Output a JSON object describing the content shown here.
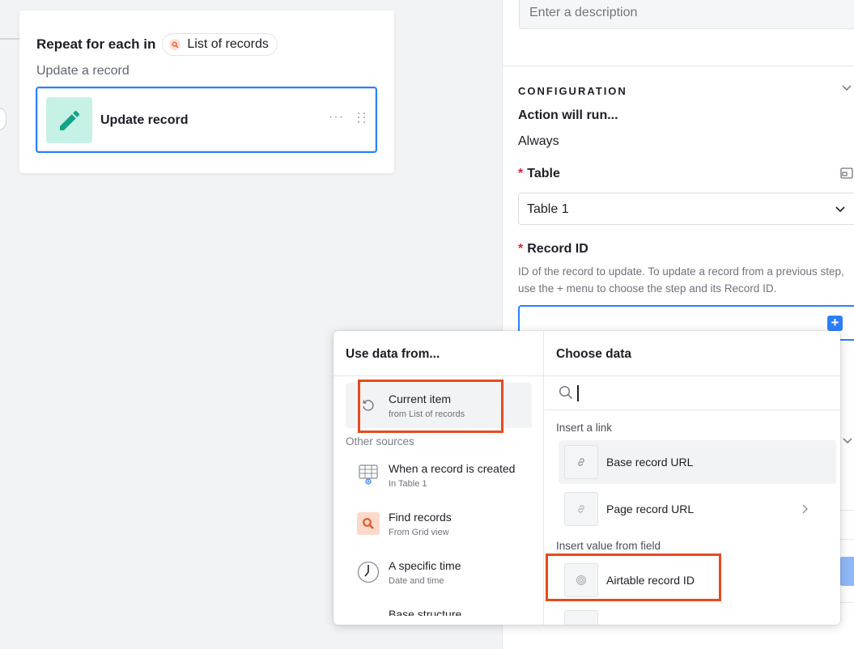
{
  "canvas": {
    "repeat_title": "Repeat for each in",
    "list_pill_label": "List of records",
    "update_label": "Update a record",
    "action_card_name": "Update record",
    "more_glyph": "···"
  },
  "panel": {
    "description_placeholder": "Enter a description",
    "config_title": "CONFIGURATION",
    "action_runs_label": "Action will run...",
    "action_runs_value": "Always",
    "required_mark": "*",
    "table_label": "Table",
    "table_value": "Table 1",
    "record_id_label": "Record ID",
    "record_id_help": "ID of the record to update. To update a record from a previous step, use the + menu to choose the step and its Record ID.",
    "plus_glyph": "+"
  },
  "popover": {
    "left_header": "Use data from...",
    "right_header": "Choose data",
    "current_item": {
      "title": "Current item",
      "sub": "from List of records"
    },
    "other_sources_label": "Other sources",
    "sources": [
      {
        "title": "When a record is created",
        "sub": "In Table 1",
        "icon": "table-created-icon"
      },
      {
        "title": "Find records",
        "sub": "From Grid view",
        "icon": "find-records-icon"
      },
      {
        "title": "A specific time",
        "sub": "Date and time",
        "icon": "clock-icon"
      },
      {
        "title": "Base structure",
        "sub": "",
        "icon": "base-structure-icon"
      }
    ],
    "search_placeholder": "",
    "insert_link_label": "Insert a link",
    "links": [
      {
        "label": "Base record URL",
        "icon": "link-icon"
      },
      {
        "label": "Page record URL",
        "icon": "link-icon"
      }
    ],
    "insert_field_label": "Insert value from field",
    "fields": [
      {
        "label": "Airtable record ID",
        "icon": "fingerprint-icon"
      }
    ]
  },
  "colors": {
    "accent_blue": "#2d7ff9",
    "highlight_red": "#e84a1c",
    "update_icon_bg": "#c6f1e6",
    "update_icon_fg": "#11a386"
  }
}
